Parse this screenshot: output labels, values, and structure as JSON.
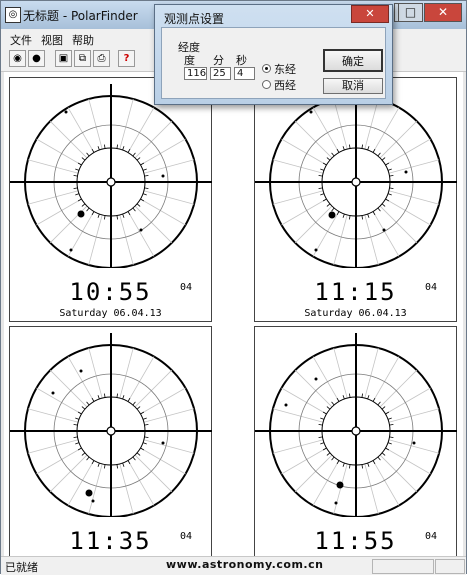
{
  "window": {
    "title": "无标题 - PolarFinder",
    "app_icon": "compass-icon"
  },
  "window_controls": {
    "minimize": "▬",
    "maximize": "□",
    "close": "✕"
  },
  "menu": [
    {
      "label": "文件"
    },
    {
      "label": "视图"
    },
    {
      "label": "帮助"
    }
  ],
  "toolbar": [
    "target-icon",
    "moon-icon",
    "save-icon",
    "copy-icon",
    "print-icon",
    "help-icon"
  ],
  "panels": [
    {
      "time": "10:55",
      "seconds": "04",
      "date": "Saturday 06.04.13"
    },
    {
      "time": "11:15",
      "seconds": "04",
      "date": "Saturday 06.04.13"
    },
    {
      "time": "11:35",
      "seconds": "04",
      "date": ""
    },
    {
      "time": "11:55",
      "seconds": "04",
      "date": ""
    }
  ],
  "status": {
    "text": "已就绪"
  },
  "watermark": "www.astronomy.com.cn",
  "dialog": {
    "title": "观测点设置",
    "group_label": "经度",
    "degree_label": "度",
    "minute_label": "分",
    "second_label": "秒",
    "degree_value": "116",
    "minute_value": "25",
    "second_value": "4",
    "east_label": "东经",
    "west_label": "西经",
    "selected": "东经",
    "ok_label": "确定",
    "cancel_label": "取消",
    "close_glyph": "✕"
  }
}
